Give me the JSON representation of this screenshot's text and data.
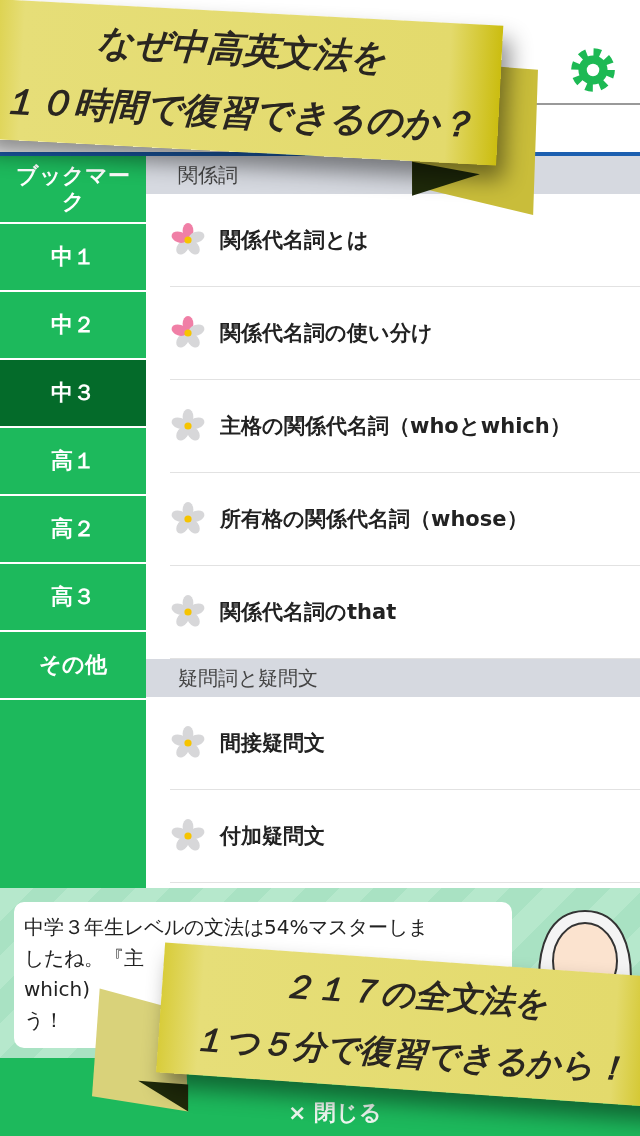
{
  "sidebar": {
    "items": [
      {
        "label": "ブックマーク",
        "selected": false
      },
      {
        "label": "中１",
        "selected": false
      },
      {
        "label": "中２",
        "selected": false
      },
      {
        "label": "中３",
        "selected": true
      },
      {
        "label": "高１",
        "selected": false
      },
      {
        "label": "高２",
        "selected": false
      },
      {
        "label": "高３",
        "selected": false
      },
      {
        "label": "その他",
        "selected": false
      }
    ]
  },
  "sections": [
    {
      "title": "関係詞",
      "lessons": [
        {
          "title": "関係代名詞とは",
          "kind": "started"
        },
        {
          "title": "関係代名詞の使い分け",
          "kind": "started"
        },
        {
          "title": "主格の関係代名詞（whoとwhich）",
          "kind": "new"
        },
        {
          "title": "所有格の関係代名詞（whose）",
          "kind": "new"
        },
        {
          "title": "関係代名詞のthat",
          "kind": "new"
        }
      ]
    },
    {
      "title": "疑問詞と疑問文",
      "lessons": [
        {
          "title": "間接疑問文",
          "kind": "new"
        },
        {
          "title": "付加疑問文",
          "kind": "new"
        }
      ]
    }
  ],
  "advisor": {
    "message_lines": [
      "中学３年生レベルの文法は54%マスターしま",
      "したね。『主",
      "which)",
      "う！"
    ]
  },
  "close_button": {
    "icon": "×",
    "label": "閉じる"
  },
  "promo_banners": [
    {
      "lines": [
        "なぜ中高英文法を",
        "１０時間で復習できるのか？"
      ]
    },
    {
      "lines": [
        "２１７の全文法を",
        "１つ５分で復習できるから！"
      ]
    }
  ]
}
